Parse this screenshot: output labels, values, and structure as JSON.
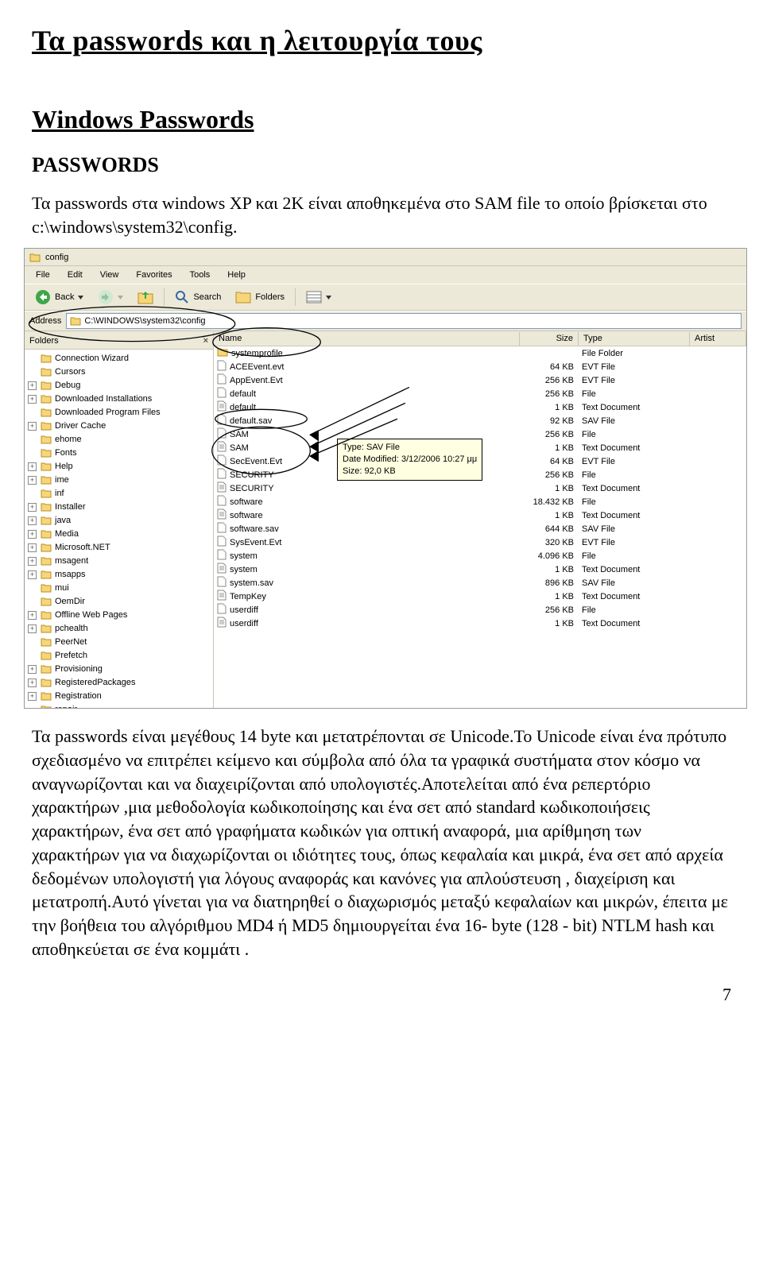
{
  "page": {
    "title": "Τα passwords και η λειτουργία τους",
    "section": "Windows Passwords",
    "subsection": "PASSWORDS",
    "p1": "Τα passwords στα windows XP και 2Κ είναι αποθηκεμένα στο SAM file το οποίο βρίσκεται στο c:\\windows\\system32\\config.",
    "p2": "Τα passwords είναι μεγέθους 14 byte και μετατρέπονται σε Unicode.Το Unicode είναι ένα πρότυπο σχεδιασμένο να επιτρέπει κείμενο και σύμβολα από όλα τα γραφικά συστήματα στον κόσμο να αναγνωρίζονται και να διαχειρίζονται από υπολογιστές.Αποτελείται από ένα ρεπερτόριο χαρακτήρων ,μια μεθοδολογία κωδικοποίησης και ένα σετ από standard κωδικοποιήσεις χαρακτήρων, ένα σετ από γραφήματα κωδικών για οπτική αναφορά, μια αρίθμηση των χαρακτήρων για να διαχωρίζονται οι ιδιότητες τους, όπως κεφαλαία και μικρά, ένα σετ από αρχεία δεδομένων υπολογιστή για λόγους αναφοράς και κανόνες για απλούστευση , διαχείριση και μετατροπή.Αυτό γίνεται για να διατηρηθεί ο διαχωρισμός μεταξύ κεφαλαίων και μικρών, έπειτα με την βοήθεια του αλγόριθμου MD4 ή MD5 δημιουργείται ένα 16- byte (128 - bit)  NTLM hash και αποθηκεύεται σε ένα κομμάτι .",
    "page_number": "7"
  },
  "explorer": {
    "window_title": "config",
    "menu": [
      "File",
      "Edit",
      "View",
      "Favorites",
      "Tools",
      "Help"
    ],
    "toolbar": {
      "back": "Back",
      "search": "Search",
      "folders": "Folders"
    },
    "address_label": "Address",
    "address_value": "C:\\WINDOWS\\system32\\config",
    "folders_label": "Folders",
    "headers": {
      "name": "Name",
      "size": "Size",
      "type": "Type",
      "artist": "Artist"
    },
    "tree": [
      {
        "pm": "",
        "label": "Connection Wizard"
      },
      {
        "pm": "",
        "label": "Cursors"
      },
      {
        "pm": "+",
        "label": "Debug"
      },
      {
        "pm": "+",
        "label": "Downloaded Installations"
      },
      {
        "pm": "",
        "label": "Downloaded Program Files"
      },
      {
        "pm": "+",
        "label": "Driver Cache"
      },
      {
        "pm": "",
        "label": "ehome"
      },
      {
        "pm": "",
        "label": "Fonts"
      },
      {
        "pm": "+",
        "label": "Help"
      },
      {
        "pm": "+",
        "label": "ime"
      },
      {
        "pm": "",
        "label": "inf"
      },
      {
        "pm": "+",
        "label": "Installer"
      },
      {
        "pm": "+",
        "label": "java"
      },
      {
        "pm": "+",
        "label": "Media"
      },
      {
        "pm": "+",
        "label": "Microsoft.NET"
      },
      {
        "pm": "+",
        "label": "msagent"
      },
      {
        "pm": "+",
        "label": "msapps"
      },
      {
        "pm": "",
        "label": "mui"
      },
      {
        "pm": "",
        "label": "OemDir"
      },
      {
        "pm": "+",
        "label": "Offline Web Pages"
      },
      {
        "pm": "+",
        "label": "pchealth"
      },
      {
        "pm": "",
        "label": "PeerNet"
      },
      {
        "pm": "",
        "label": "Prefetch"
      },
      {
        "pm": "+",
        "label": "Provisioning"
      },
      {
        "pm": "+",
        "label": "RegisteredPackages"
      },
      {
        "pm": "+",
        "label": "Registration"
      },
      {
        "pm": "",
        "label": "repair"
      }
    ],
    "files": [
      {
        "name": "systemprofile",
        "size": "",
        "type": "File Folder",
        "icon": "folder"
      },
      {
        "name": "ACEEvent.evt",
        "size": "64 KB",
        "type": "EVT File",
        "icon": "file"
      },
      {
        "name": "AppEvent.Evt",
        "size": "256 KB",
        "type": "EVT File",
        "icon": "file"
      },
      {
        "name": "default",
        "size": "256 KB",
        "type": "File",
        "icon": "file"
      },
      {
        "name": "default",
        "size": "1 KB",
        "type": "Text Document",
        "icon": "txt"
      },
      {
        "name": "default.sav",
        "size": "92 KB",
        "type": "SAV File",
        "icon": "file"
      },
      {
        "name": "SAM",
        "size": "256 KB",
        "type": "File",
        "icon": "file"
      },
      {
        "name": "SAM",
        "size": "1 KB",
        "type": "Text Document",
        "icon": "txt"
      },
      {
        "name": "SecEvent.Evt",
        "size": "64 KB",
        "type": "EVT File",
        "icon": "file"
      },
      {
        "name": "SECURITY",
        "size": "256 KB",
        "type": "File",
        "icon": "file"
      },
      {
        "name": "SECURITY",
        "size": "1 KB",
        "type": "Text Document",
        "icon": "txt"
      },
      {
        "name": "software",
        "size": "18.432 KB",
        "type": "File",
        "icon": "file"
      },
      {
        "name": "software",
        "size": "1 KB",
        "type": "Text Document",
        "icon": "txt"
      },
      {
        "name": "software.sav",
        "size": "644 KB",
        "type": "SAV File",
        "icon": "file"
      },
      {
        "name": "SysEvent.Evt",
        "size": "320 KB",
        "type": "EVT File",
        "icon": "file"
      },
      {
        "name": "system",
        "size": "4.096 KB",
        "type": "File",
        "icon": "file"
      },
      {
        "name": "system",
        "size": "1 KB",
        "type": "Text Document",
        "icon": "txt"
      },
      {
        "name": "system.sav",
        "size": "896 KB",
        "type": "SAV File",
        "icon": "file"
      },
      {
        "name": "TempKey",
        "size": "1 KB",
        "type": "Text Document",
        "icon": "txt"
      },
      {
        "name": "userdiff",
        "size": "256 KB",
        "type": "File",
        "icon": "file"
      },
      {
        "name": "userdiff",
        "size": "1 KB",
        "type": "Text Document",
        "icon": "txt"
      }
    ],
    "tooltip": {
      "line1": "Type: SAV File",
      "line2": "Date Modified: 3/12/2006 10:27 μμ",
      "line3": "Size: 92,0 KB"
    }
  }
}
